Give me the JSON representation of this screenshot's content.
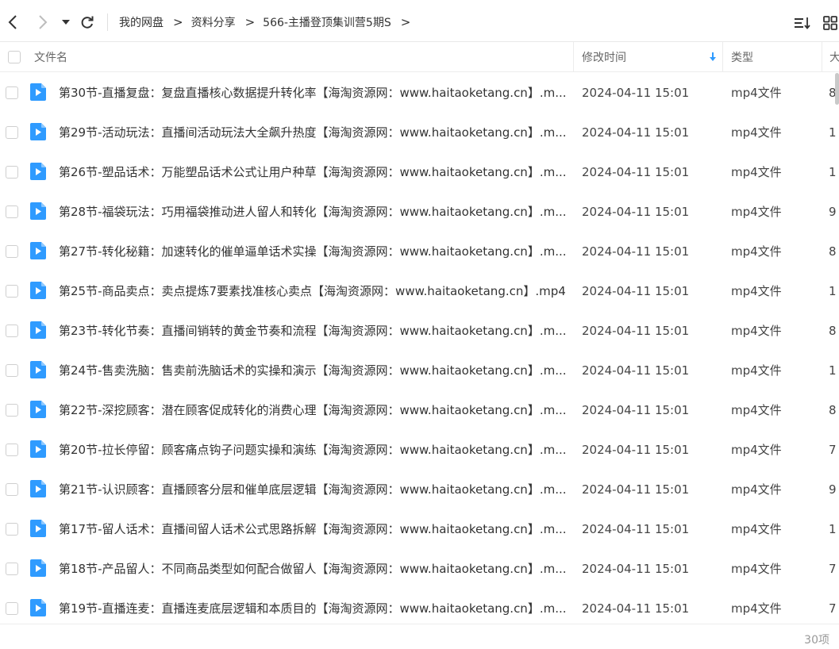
{
  "toolbar": {
    "back_icon": "chevron-left-icon",
    "forward_icon": "chevron-right-icon",
    "dropdown_icon": "caret-down-icon",
    "refresh_icon": "refresh-icon",
    "breadcrumb": [
      "我的网盘",
      "资料分享",
      "566-主播登顶集训营5期S"
    ],
    "sort_icon": "sort-list-icon",
    "grid_icon": "grid-view-icon"
  },
  "header": {
    "name": "文件名",
    "modified": "修改时间",
    "type": "类型",
    "size": "大"
  },
  "files": [
    {
      "name": "第30节-直播复盘：复盘直播核心数据提升转化率【海淘资源网：www.haitaoketang.cn】.m...",
      "date": "2024-04-11 15:01",
      "type": "mp4文件",
      "size": "8"
    },
    {
      "name": "第29节-活动玩法：直播间活动玩法大全飙升热度【海淘资源网：www.haitaoketang.cn】.m...",
      "date": "2024-04-11 15:01",
      "type": "mp4文件",
      "size": "1"
    },
    {
      "name": "第26节-塑品话术：万能塑品话术公式让用户种草【海淘资源网：www.haitaoketang.cn】.m...",
      "date": "2024-04-11 15:01",
      "type": "mp4文件",
      "size": "1"
    },
    {
      "name": "第28节-福袋玩法：巧用福袋推动进人留人和转化【海淘资源网：www.haitaoketang.cn】.m...",
      "date": "2024-04-11 15:01",
      "type": "mp4文件",
      "size": "9"
    },
    {
      "name": "第27节-转化秘籍：加速转化的催单逼单话术实操【海淘资源网：www.haitaoketang.cn】.m...",
      "date": "2024-04-11 15:01",
      "type": "mp4文件",
      "size": "8"
    },
    {
      "name": "第25节-商品卖点：卖点提炼7要素找准核心卖点【海淘资源网：www.haitaoketang.cn】.mp4",
      "date": "2024-04-11 15:01",
      "type": "mp4文件",
      "size": "1"
    },
    {
      "name": "第23节-转化节奏：直播间销转的黄金节奏和流程【海淘资源网：www.haitaoketang.cn】.m...",
      "date": "2024-04-11 15:01",
      "type": "mp4文件",
      "size": "8"
    },
    {
      "name": "第24节-售卖洗脑：售卖前洗脑话术的实操和演示【海淘资源网：www.haitaoketang.cn】.m...",
      "date": "2024-04-11 15:01",
      "type": "mp4文件",
      "size": "1"
    },
    {
      "name": "第22节-深挖顾客：潜在顾客促成转化的消费心理【海淘资源网：www.haitaoketang.cn】.m...",
      "date": "2024-04-11 15:01",
      "type": "mp4文件",
      "size": "8"
    },
    {
      "name": "第20节-拉长停留：顾客痛点钩子问题实操和演练【海淘资源网：www.haitaoketang.cn】.m...",
      "date": "2024-04-11 15:01",
      "type": "mp4文件",
      "size": "7"
    },
    {
      "name": "第21节-认识顾客：直播顾客分层和催单底层逻辑【海淘资源网：www.haitaoketang.cn】.m...",
      "date": "2024-04-11 15:01",
      "type": "mp4文件",
      "size": "9"
    },
    {
      "name": "第17节-留人话术：直播间留人话术公式思路拆解【海淘资源网：www.haitaoketang.cn】.m...",
      "date": "2024-04-11 15:01",
      "type": "mp4文件",
      "size": "1"
    },
    {
      "name": "第18节-产品留人：不同商品类型如何配合做留人【海淘资源网：www.haitaoketang.cn】.m...",
      "date": "2024-04-11 15:01",
      "type": "mp4文件",
      "size": "7"
    },
    {
      "name": "第19节-直播连麦：直播连麦底层逻辑和本质目的【海淘资源网：www.haitaoketang.cn】.m...",
      "date": "2024-04-11 15:01",
      "type": "mp4文件",
      "size": "7"
    }
  ],
  "footer": {
    "count": "30项"
  },
  "colors": {
    "file_icon": "#2f9bff",
    "sort_arrow": "#2f9bff"
  }
}
